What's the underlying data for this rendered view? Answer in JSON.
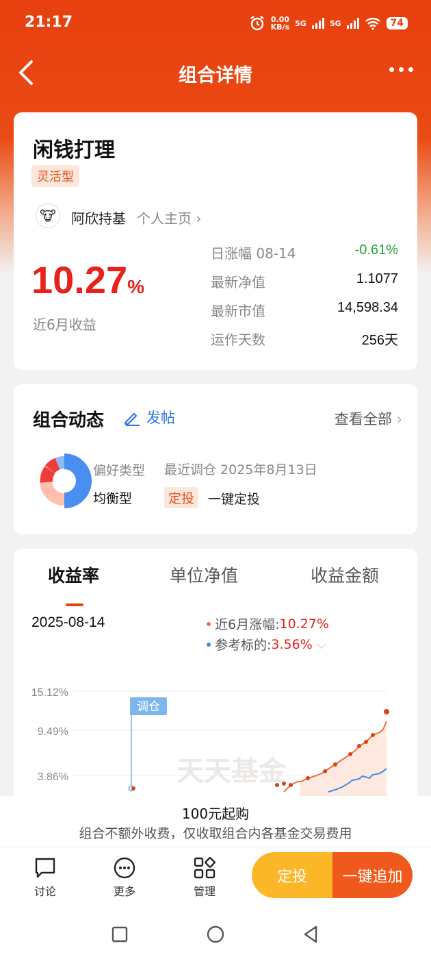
{
  "status": {
    "time": "21:17",
    "speed_top": "0.00",
    "speed_bottom": "KB/s",
    "net1": "5G",
    "net2": "5G",
    "battery": "74"
  },
  "nav": {
    "title": "组合详情"
  },
  "fund": {
    "name": "闲钱打理",
    "tag": "灵活型",
    "author": "阿欣持基",
    "author_link": "个人主页",
    "return_value": "10.27",
    "return_unit": "%",
    "return_label": "近6月收益",
    "stats": [
      {
        "label": "日涨幅 08-14",
        "value": "-0.61%"
      },
      {
        "label": "最新净值",
        "value": "1.1077"
      },
      {
        "label": "最新市值",
        "value": "14,598.34"
      },
      {
        "label": "运作天数",
        "value": "256天"
      }
    ]
  },
  "dynamics": {
    "title": "组合动态",
    "post": "发帖",
    "view_all": "查看全部",
    "pref_label": "偏好类型",
    "pref_value": "均衡型",
    "adjust": "最近调仓 2025年8月13日",
    "dt_tag": "定投",
    "dt_text": "一键定投"
  },
  "chart": {
    "tabs": [
      "收益率",
      "单位净值",
      "收益金额"
    ],
    "date": "2025-08-14",
    "legend": [
      {
        "label": "近6月涨幅:",
        "value": "10.27%",
        "color": "#ef6f3c"
      },
      {
        "label": "参考标的:",
        "value": "3.56%",
        "color": "#3d8be8"
      }
    ],
    "y_ticks": [
      "15.12%",
      "9.49%",
      "3.86%"
    ],
    "marker": "调仓",
    "watermark": "天天基金"
  },
  "chart_data": {
    "type": "line",
    "y_ticks": [
      "15.12%",
      "9.49%",
      "3.86%"
    ],
    "series": [
      {
        "name": "近6月涨幅",
        "final": 10.27
      },
      {
        "name": "参考标的",
        "final": 3.56
      }
    ]
  },
  "bottom": {
    "notice_title": "100元起购",
    "notice_sub": "组合不额外收费，仅收取组合内各基金交易费用",
    "tools": [
      "讨论",
      "更多",
      "管理"
    ],
    "cta_a": "定投",
    "cta_b": "一键追加"
  }
}
